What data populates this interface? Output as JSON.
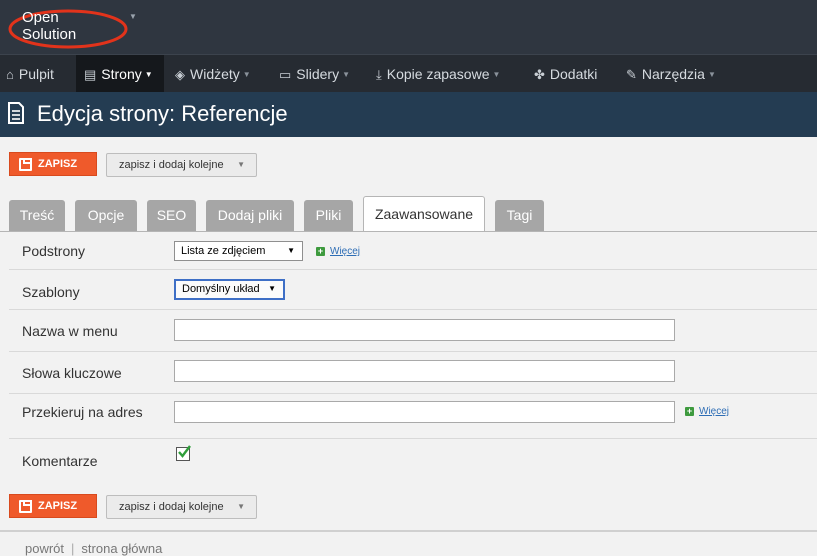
{
  "app": {
    "logo_text": [
      "Open",
      "Solution"
    ]
  },
  "menu": [
    {
      "label": "Pulpit",
      "icon": "home-icon",
      "glyph": "⌂",
      "caret": false,
      "active": false
    },
    {
      "label": "Strony",
      "icon": "page-icon",
      "glyph": "▤",
      "caret": true,
      "active": true
    },
    {
      "label": "Widżety",
      "icon": "cube-icon",
      "glyph": "◈",
      "caret": true,
      "active": false
    },
    {
      "label": "Slidery",
      "icon": "image-icon",
      "glyph": "▭",
      "caret": true,
      "active": false
    },
    {
      "label": "Kopie zapasowe",
      "icon": "download-icon",
      "glyph": "⤓",
      "caret": true,
      "active": false
    },
    {
      "label": "Dodatki",
      "icon": "puzzle-icon",
      "glyph": "✤",
      "caret": false,
      "active": false
    },
    {
      "label": "Narzędzia",
      "icon": "wrench-icon",
      "glyph": "✎",
      "caret": true,
      "active": false
    }
  ],
  "page": {
    "title": "Edycja strony: Referencje"
  },
  "actions": {
    "save_label": "ZAPISZ",
    "save_add_label": "zapisz i dodaj kolejne"
  },
  "tabs": [
    {
      "label": "Treść",
      "active": false
    },
    {
      "label": "Opcje",
      "active": false
    },
    {
      "label": "SEO",
      "active": false
    },
    {
      "label": "Dodaj pliki",
      "active": false
    },
    {
      "label": "Pliki",
      "active": false
    },
    {
      "label": "Zaawansowane",
      "active": true
    },
    {
      "label": "Tagi",
      "active": false
    }
  ],
  "form": {
    "podstrony": {
      "label": "Podstrony",
      "value": "Lista ze zdjęciem",
      "more": "Więcej"
    },
    "szablony": {
      "label": "Szablony",
      "value": "Domyślny układ"
    },
    "nazwa_menu": {
      "label": "Nazwa w menu",
      "value": ""
    },
    "slowa_kluczowe": {
      "label": "Słowa kluczowe",
      "value": ""
    },
    "przekieruj": {
      "label": "Przekieruj na adres",
      "value": "",
      "more": "Więcej"
    },
    "komentarze": {
      "label": "Komentarze",
      "checked": true
    }
  },
  "footer": {
    "back": "powrót",
    "home": "strona główna"
  },
  "colors": {
    "save": "#ef5a2b",
    "title_bar": "#243c52",
    "menu_bar": "#262b32",
    "link": "#2d6db5",
    "check": "#2f9e3a"
  }
}
